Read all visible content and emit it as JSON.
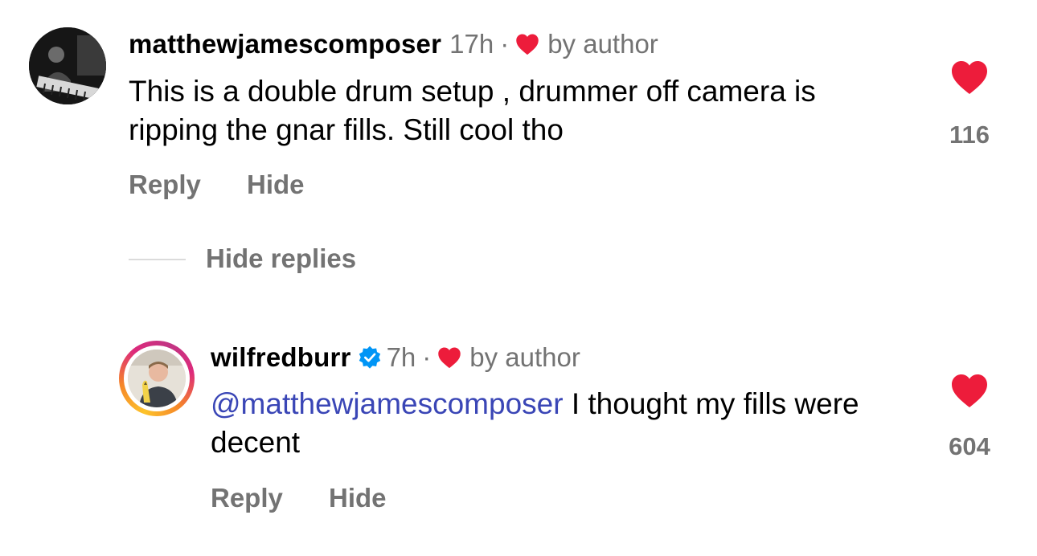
{
  "comments": [
    {
      "username": "matthewjamescomposer",
      "time": "17h",
      "separator": "·",
      "liked_label": "by author",
      "text": "This is a double drum setup , drummer off camera is ripping the gnar fills. Still cool tho",
      "reply_label": "Reply",
      "hide_label": "Hide",
      "like_count": "116",
      "liked": true,
      "avatar_icon": "avatar-photo-icon"
    }
  ],
  "replies_toggle": {
    "label": "Hide replies"
  },
  "replies": [
    {
      "username": "wilfredburr",
      "verified": true,
      "verified_icon": "verified-badge-icon",
      "time": "7h",
      "separator": "·",
      "liked_label": "by author",
      "mention": "@matthewjamescomposer",
      "text": " I thought my fills were decent",
      "reply_label": "Reply",
      "hide_label": "Hide",
      "like_count": "604",
      "liked": true,
      "has_story_ring": true
    }
  ],
  "colors": {
    "like_red": "#ed1c3b",
    "secondary_text": "#737373",
    "mention_blue": "#3a46b6",
    "verified_blue": "#0095f6",
    "divider": "#dbdbdb"
  }
}
